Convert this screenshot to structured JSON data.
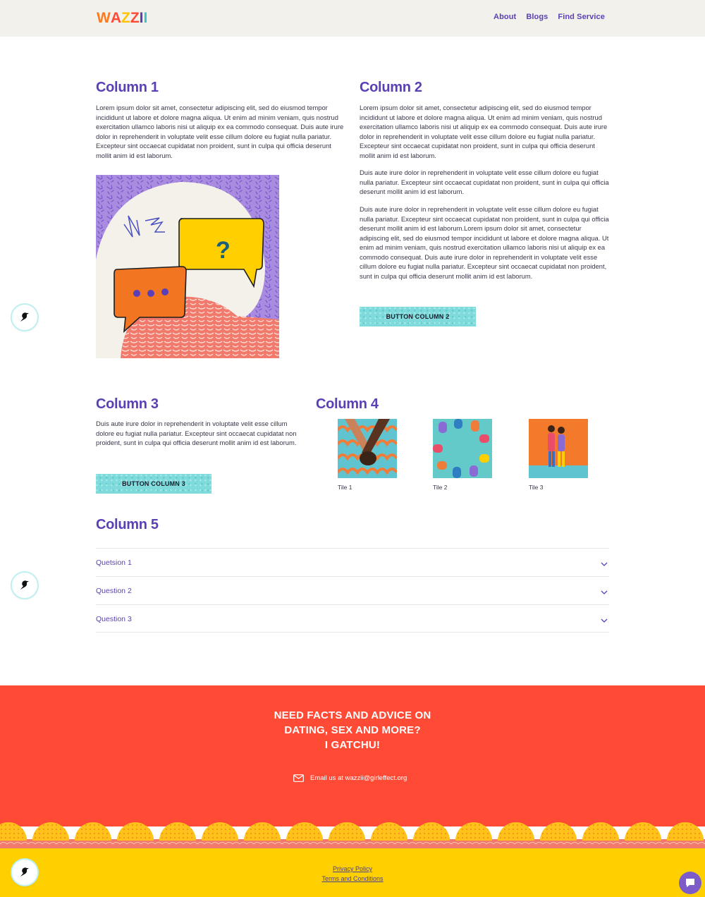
{
  "header": {
    "logo_text": "WAZZII",
    "nav": [
      "About",
      "Blogs",
      "Find Service"
    ]
  },
  "col1": {
    "title": "Column 1",
    "text": "Lorem ipsum dolor sit amet, consectetur adipiscing elit, sed do eiusmod tempor incididunt ut labore et dolore magna aliqua. Ut enim ad minim veniam, quis nostrud exercitation ullamco laboris nisi ut aliquip ex ea commodo consequat. Duis aute irure dolor in reprehenderit in voluptate velit esse cillum dolore eu fugiat nulla pariatur. Excepteur sint occaecat cupidatat non proident, sunt in culpa qui officia deserunt mollit anim id est laborum."
  },
  "col2": {
    "title": "Column 2",
    "p1": "Lorem ipsum dolor sit amet, consectetur adipiscing elit, sed do eiusmod tempor incididunt ut labore et dolore magna aliqua. Ut enim ad minim veniam, quis nostrud exercitation ullamco laboris nisi ut aliquip ex ea commodo consequat. Duis aute irure dolor in reprehenderit in voluptate velit esse cillum dolore eu fugiat nulla pariatur. Excepteur sint occaecat cupidatat non proident, sunt in culpa qui officia deserunt mollit anim id est laborum.",
    "p2": "Duis aute irure dolor in reprehenderit in voluptate velit esse cillum dolore eu fugiat nulla pariatur. Excepteur sint occaecat cupidatat non proident, sunt in culpa qui officia deserunt mollit anim id est laborum.",
    "p3": "Duis aute irure dolor in reprehenderit in voluptate velit esse cillum dolore eu fugiat nulla pariatur. Excepteur sint occaecat cupidatat non proident, sunt in culpa qui officia deserunt mollit anim id est laborum.Lorem ipsum dolor sit amet, consectetur adipiscing elit, sed do eiusmod tempor incididunt ut labore et dolore magna aliqua. Ut enim ad minim veniam, quis nostrud exercitation ullamco laboris nisi ut aliquip ex ea commodo consequat. Duis aute irure dolor in reprehenderit in voluptate velit esse cillum dolore eu fugiat nulla pariatur. Excepteur sint occaecat cupidatat non proident, sunt in culpa qui officia deserunt mollit anim id est laborum.",
    "button": "BUTTON COLUMN 2"
  },
  "col3": {
    "title": "Column 3",
    "text": "Duis aute irure dolor in reprehenderit in voluptate velit esse cillum dolore eu fugiat nulla pariatur. Excepteur sint occaecat cupidatat non proident, sunt in culpa qui officia deserunt mollit anim id est laborum.",
    "button": "BUTTON COLUMN 3"
  },
  "col4": {
    "title": "Column 4",
    "tiles": [
      "Tile 1",
      "Tile 2",
      "Tile 3"
    ]
  },
  "col5": {
    "title": "Column 5",
    "questions": [
      "Quetsion 1",
      "Question 2",
      "Question 3"
    ]
  },
  "footer": {
    "cta_line1": "NEED FACTS AND ADVICE ON",
    "cta_line2": "DATING, SEX AND MORE?",
    "cta_line3": "I GATCHU!",
    "email_text": "Email us at wazzii@girleffect.org",
    "privacy": "Privacy Policy",
    "terms": "Terms and Conditions"
  },
  "colors": {
    "accent": "#5b3fb6",
    "cta_bg": "#ff4a36",
    "bottom_bg": "#ffd000",
    "button_bg": "#7fdadb"
  }
}
